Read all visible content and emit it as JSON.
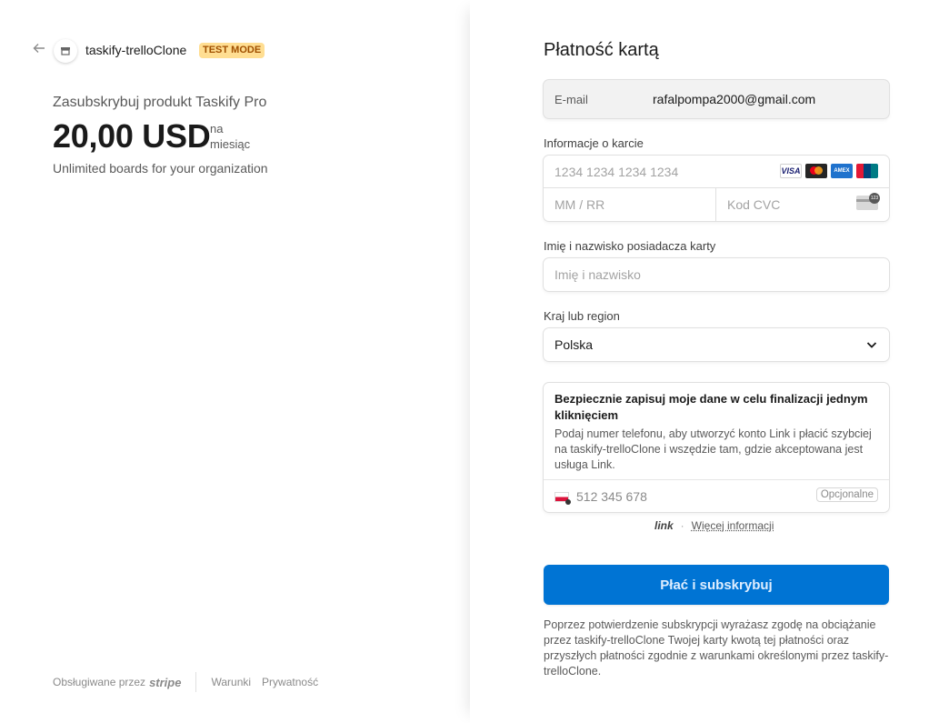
{
  "merchant": {
    "name": "taskify-trelloClone",
    "badge": "TEST MODE",
    "back_icon": "arrow-left-icon",
    "avatar_icon": "store-icon"
  },
  "product": {
    "title": "Zasubskrybuj produkt Taskify Pro",
    "price": "20,00 USD",
    "price_unit_line1": "na",
    "price_unit_line2": "miesiąc",
    "description": "Unlimited boards for your organization"
  },
  "footer": {
    "powered_by": "Obsługiwane przez",
    "brand": "stripe",
    "terms": "Warunki",
    "privacy": "Prywatność"
  },
  "form": {
    "title": "Płatność kartą",
    "email_label": "E-mail",
    "email_value": "rafalpompa2000@gmail.com",
    "card_label": "Informacje o karcie",
    "card_number_placeholder": "1234 1234 1234 1234",
    "card_brands": [
      "VISA",
      "mastercard",
      "AMEX",
      "UnionPay"
    ],
    "expiry_placeholder": "MM / RR",
    "cvc_placeholder": "Kod CVC",
    "name_label": "Imię i nazwisko posiadacza karty",
    "name_placeholder": "Imię i nazwisko",
    "country_label": "Kraj lub region",
    "country_value": "Polska",
    "link_title": "Bezpiecznie zapisuj moje dane w celu finalizacji jednym kliknięciem",
    "link_body": "Podaj numer telefonu, aby utworzyć konto Link i płacić szybciej na taskify-trelloClone i wszędzie tam, gdzie akceptowana jest usługa Link.",
    "phone_placeholder": "512 345 678",
    "phone_optional": "Opcjonalne",
    "link_logo": "link",
    "link_more": "Więcej informacji",
    "pay_button": "Płać i subskrybuj",
    "terms_text": "Poprzez potwierdzenie subskrypcji wyrażasz zgodę na obciążanie przez taskify-trelloClone Twojej karty kwotą tej płatności oraz przyszłych płatności zgodnie z warunkami określonymi przez taskify-trelloClone."
  },
  "colors": {
    "accent": "#0074d4",
    "badge_bg": "#ffde92",
    "badge_text": "#a04f00"
  }
}
